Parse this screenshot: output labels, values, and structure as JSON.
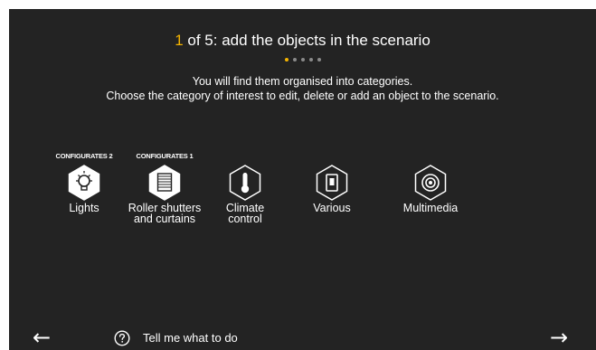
{
  "header": {
    "step_current": "1",
    "step_rest": " of 5: add the objects in the scenario",
    "pager_active_index": 0,
    "pager_count": 5
  },
  "instructions": {
    "line1": "You will find them organised into categories.",
    "line2": "Choose the category of interest to edit, delete or add an object to the scenario."
  },
  "categories": [
    {
      "label": "Lights",
      "badge": "CONFIGURATES 2",
      "icon": "lightbulb-icon",
      "active": true
    },
    {
      "label": "Roller shutters\nand curtains",
      "badge": "CONFIGURATES 1",
      "icon": "roller-shutter-icon",
      "active": true
    },
    {
      "label": "Climate\ncontrol",
      "badge": "",
      "icon": "thermometer-icon",
      "active": false
    },
    {
      "label": "Various",
      "badge": "",
      "icon": "switch-icon",
      "active": false
    },
    {
      "label": "Multimedia",
      "badge": "",
      "icon": "speaker-icon",
      "active": false
    }
  ],
  "footer": {
    "back_arrow": "←",
    "next_arrow": "→",
    "help_text": "Tell me what to do"
  },
  "colors": {
    "background": "#232323",
    "accent": "#f5b400",
    "text": "#ffffff"
  }
}
